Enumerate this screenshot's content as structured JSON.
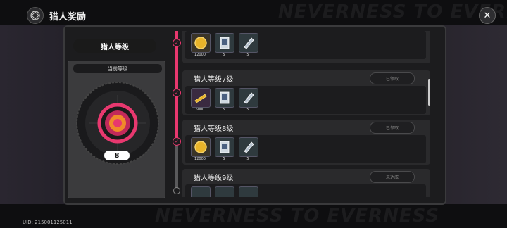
{
  "header": {
    "title": "猎人奖励",
    "close_icon": "close-icon"
  },
  "watermark": "NEVERNESS TO EVERNESS",
  "uid": "UID: 215001125011",
  "left_panel": {
    "title": "猎人等级",
    "subtitle": "当前等级",
    "level": "8"
  },
  "rows": [
    {
      "title": "",
      "status": "",
      "items": [
        {
          "icon": "gold-coin-icon",
          "count": "12000"
        },
        {
          "icon": "card-icon",
          "count": "5"
        },
        {
          "icon": "crystal-icon",
          "count": "5"
        }
      ]
    },
    {
      "title": "猎人等级7级",
      "status": "已领取",
      "items": [
        {
          "icon": "bar-ticket-icon",
          "count": "6000"
        },
        {
          "icon": "card-icon",
          "count": "5"
        },
        {
          "icon": "crystal-icon",
          "count": "5"
        }
      ]
    },
    {
      "title": "猎人等级8级",
      "status": "已领取",
      "items": [
        {
          "icon": "gold-coin-icon",
          "count": "12000"
        },
        {
          "icon": "card-icon",
          "count": "5"
        },
        {
          "icon": "crystal-icon",
          "count": "5"
        }
      ]
    },
    {
      "title": "猎人等级9级",
      "status": "未达成",
      "items": []
    }
  ],
  "colors": {
    "accent": "#e8386f",
    "gold": "#e9b42a",
    "teal": "#2f3a3e"
  }
}
